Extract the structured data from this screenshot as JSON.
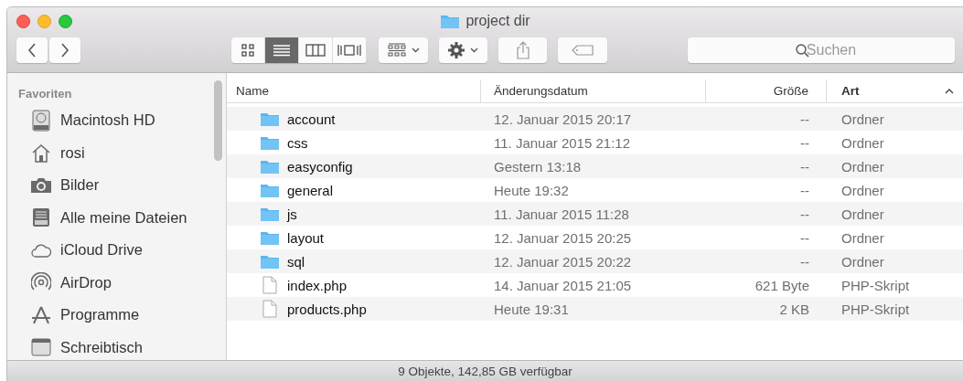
{
  "window": {
    "title": "project dir"
  },
  "toolbar": {
    "view_modes": [
      {
        "kind": "icons",
        "selected": false
      },
      {
        "kind": "list",
        "selected": true
      },
      {
        "kind": "columns",
        "selected": false
      },
      {
        "kind": "coverflow",
        "selected": false
      }
    ],
    "search": {
      "placeholder": "Suchen"
    }
  },
  "sidebar": {
    "heading": "Favoriten",
    "items": [
      {
        "label": "Macintosh HD",
        "kind": "disk"
      },
      {
        "label": "rosi",
        "kind": "home"
      },
      {
        "label": "Bilder",
        "kind": "camera"
      },
      {
        "label": "Alle meine Dateien",
        "kind": "files"
      },
      {
        "label": "iCloud Drive",
        "kind": "cloud"
      },
      {
        "label": "AirDrop",
        "kind": "airdrop"
      },
      {
        "label": "Programme",
        "kind": "apps"
      },
      {
        "label": "Schreibtisch",
        "kind": "desktop"
      }
    ]
  },
  "table": {
    "columns": [
      {
        "label": "Name",
        "sorted": false
      },
      {
        "label": "Änderungsdatum",
        "sorted": false
      },
      {
        "label": "Größe",
        "sorted": false
      },
      {
        "label": "Art",
        "sorted": true
      }
    ],
    "rows": [
      {
        "kind": "folder",
        "name": "account",
        "date": "12. Januar 2015 20:17",
        "size": "--",
        "type": "Ordner"
      },
      {
        "kind": "folder",
        "name": "css",
        "date": "11. Januar 2015 21:12",
        "size": "--",
        "type": "Ordner"
      },
      {
        "kind": "folder",
        "name": "easyconfig",
        "date": "Gestern 13:18",
        "size": "--",
        "type": "Ordner"
      },
      {
        "kind": "folder",
        "name": "general",
        "date": "Heute 19:32",
        "size": "--",
        "type": "Ordner"
      },
      {
        "kind": "folder",
        "name": "js",
        "date": "11. Januar 2015 11:28",
        "size": "--",
        "type": "Ordner"
      },
      {
        "kind": "folder",
        "name": "layout",
        "date": "12. Januar 2015 20:25",
        "size": "--",
        "type": "Ordner"
      },
      {
        "kind": "folder",
        "name": "sql",
        "date": "12. Januar 2015 20:22",
        "size": "--",
        "type": "Ordner"
      },
      {
        "kind": "file",
        "name": "index.php",
        "date": "14. Januar 2015 21:05",
        "size": "621 Byte",
        "type": "PHP-Skript"
      },
      {
        "kind": "file",
        "name": "products.php",
        "date": "Heute 19:31",
        "size": "2 KB",
        "type": "PHP-Skript"
      }
    ]
  },
  "status_bar": "9 Objekte, 142,85 GB verfügbar"
}
